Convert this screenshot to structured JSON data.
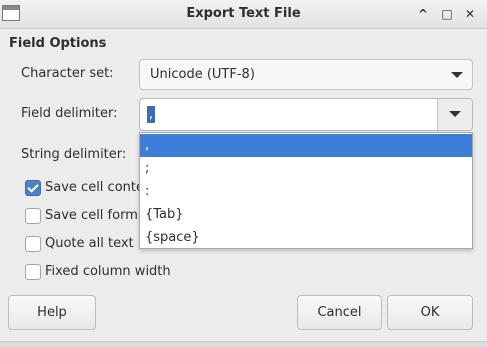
{
  "window": {
    "title": "Export Text File",
    "minimize_glyph": "^",
    "maximize_glyph": "□",
    "close_glyph": "✕"
  },
  "field_options": {
    "title": "Field Options",
    "character_set": {
      "label": "Character set:",
      "value": "Unicode (UTF-8)"
    },
    "field_delimiter": {
      "label": "Field delimiter:",
      "value": ",",
      "options": [
        ",",
        ";",
        ":",
        "{Tab}",
        "{space}"
      ],
      "selected_index": 0
    },
    "string_delimiter": {
      "label": "String delimiter:"
    },
    "checkboxes": [
      {
        "label": "Save cell conte",
        "checked": true
      },
      {
        "label": "Save cell form",
        "checked": false
      },
      {
        "label": "Quote all text",
        "checked": false
      },
      {
        "label": "Fixed column width",
        "checked": false
      }
    ]
  },
  "buttons": {
    "help": "Help",
    "cancel": "Cancel",
    "ok": "OK"
  }
}
